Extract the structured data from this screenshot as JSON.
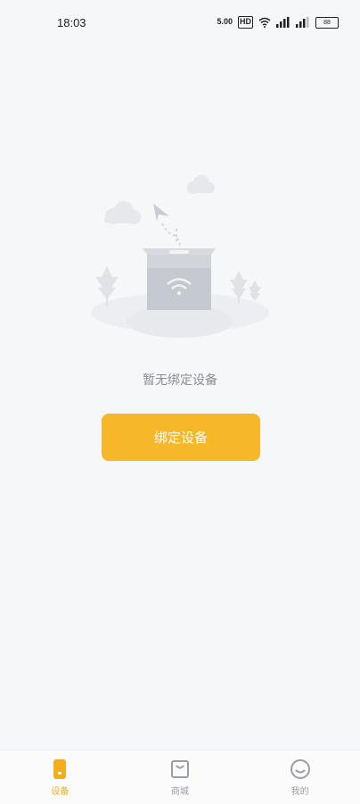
{
  "status_bar": {
    "time": "18:03",
    "icons": [
      "network-speed-icon",
      "hd-icon",
      "wifi-icon",
      "signal-icon",
      "signal-icon",
      "battery-icon"
    ],
    "network_speed": "5.00",
    "hd_label": "HD",
    "battery": "88"
  },
  "empty_state": {
    "message": "暂无绑定设备",
    "illustration_icon": "empty-box-wifi-icon"
  },
  "primary_action": {
    "label": "绑定设备",
    "color": "#f6b72a"
  },
  "tabs": [
    {
      "label": "设备",
      "icon": "device-icon",
      "active": true
    },
    {
      "label": "商城",
      "icon": "shop-icon",
      "active": false
    },
    {
      "label": "我的",
      "icon": "profile-icon",
      "active": false
    }
  ],
  "colors": {
    "accent": "#f6b72a",
    "active_tab": "#f3ae1c",
    "background": "#f6f7f9"
  }
}
